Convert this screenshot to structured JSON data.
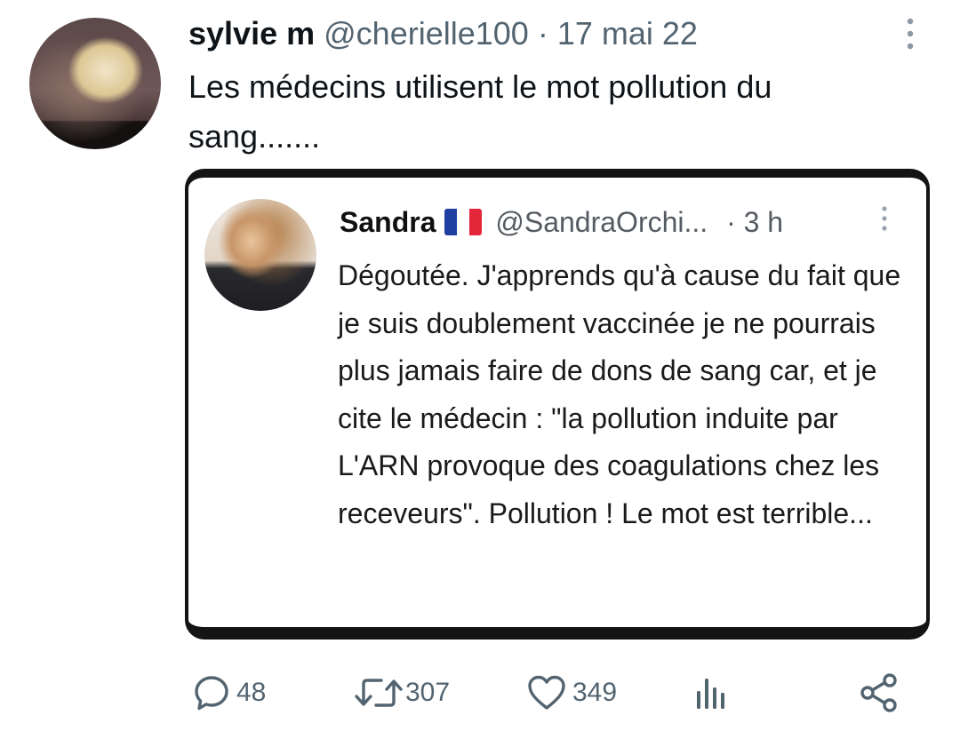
{
  "tweet": {
    "author_name": "sylvie m",
    "author_handle": "@cherielle100",
    "separator": "·",
    "date": "17 mai 22",
    "text": "Les médecins utilisent le mot pollution du sang......."
  },
  "quoted_tweet": {
    "author_name": "Sandra",
    "flag_emoji": "france-flag",
    "author_handle": "@SandraOrchi...",
    "separator": "·",
    "time": "3 h",
    "text": "Dégoutée. J'apprends qu'à cause du fait que je suis doublement vaccinée  je ne pourrais plus jamais faire de dons de sang car, et je cite le médecin : \"la pollution induite par L'ARN provoque des coagulations chez les receveurs\". Pollution ! Le mot est terrible..."
  },
  "actions": {
    "reply_count": "48",
    "retweet_count": "307",
    "like_count": "349"
  },
  "icons": {
    "reply": "reply-icon",
    "retweet": "retweet-icon",
    "like": "heart-icon",
    "analytics": "analytics-icon",
    "share": "share-icon",
    "more": "more-vertical-icon"
  },
  "colors": {
    "text": "#0f1419",
    "secondary": "#536471",
    "flag_blue": "#1f3fa0",
    "flag_red": "#e3263a"
  }
}
